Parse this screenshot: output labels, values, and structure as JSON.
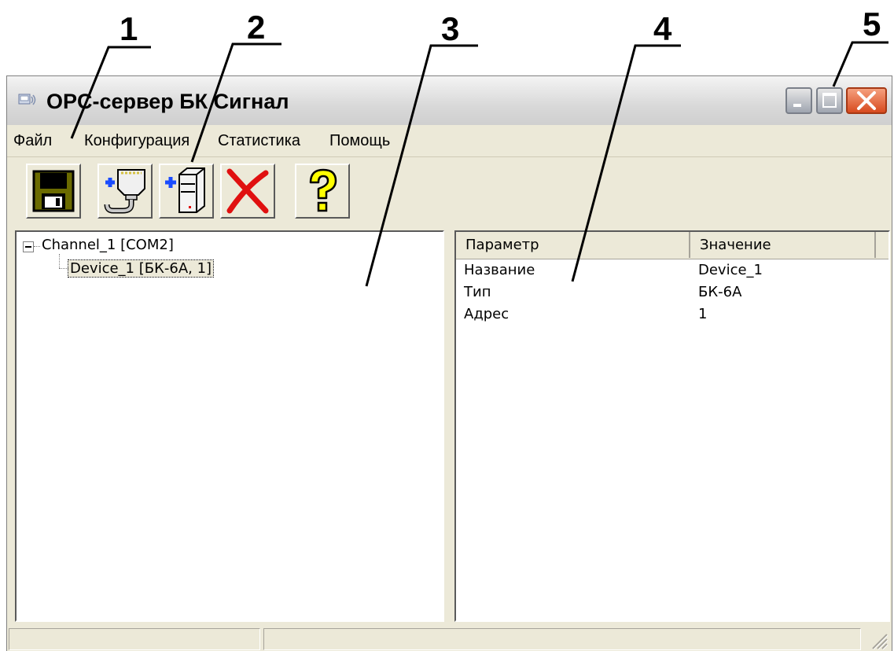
{
  "callouts": [
    "1",
    "2",
    "3",
    "4",
    "5"
  ],
  "window": {
    "title": "OPC-сервер БК Сигнал"
  },
  "menu": {
    "items": [
      "Файл",
      "Конфигурация",
      "Статистика",
      "Помощь"
    ]
  },
  "toolbar": {
    "buttons": [
      {
        "name": "save-button",
        "icon": "floppy-disk-icon"
      },
      {
        "name": "add-channel-button",
        "icon": "add-cable-icon"
      },
      {
        "name": "add-device-button",
        "icon": "add-device-icon"
      },
      {
        "name": "delete-button",
        "icon": "red-x-icon"
      },
      {
        "name": "help-button",
        "icon": "question-mark-icon"
      }
    ]
  },
  "tree": {
    "channel": "Channel_1 [COM2]",
    "device": "Device_1 [БК-6А, 1]"
  },
  "properties": {
    "headers": [
      "Параметр",
      "Значение"
    ],
    "rows": [
      {
        "param": "Название",
        "value": "Device_1"
      },
      {
        "param": "Тип",
        "value": "БК-6А"
      },
      {
        "param": "Адрес",
        "value": "1"
      }
    ]
  },
  "colors": {
    "window_bg": "#ece9d8",
    "close_button": "#d84a1e",
    "help_yellow": "#ffff00",
    "delete_red": "#e01010",
    "save_green": "#6b6b00"
  }
}
